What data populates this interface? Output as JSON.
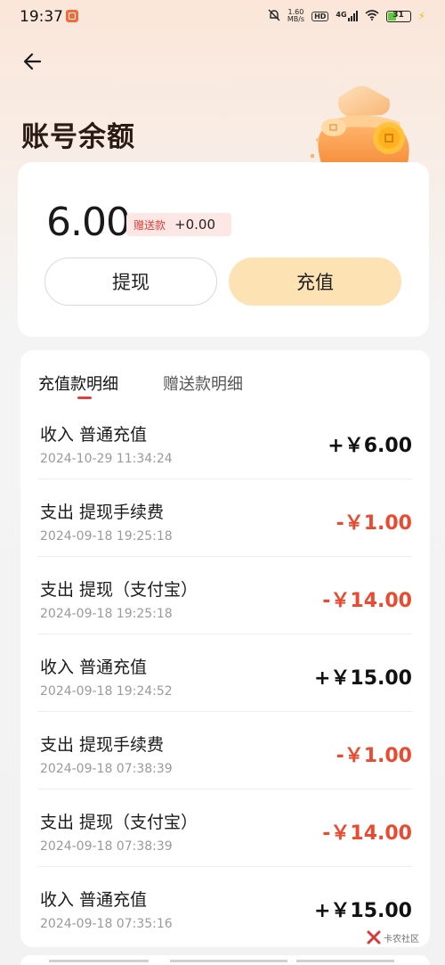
{
  "status_bar": {
    "time": "19:37",
    "net_speed_value": "1.60",
    "net_speed_unit": "MB/s",
    "hd_label": "HD",
    "network_type": "4G",
    "battery": "31"
  },
  "header": {
    "title": "账号余额"
  },
  "balance": {
    "amount": "6.00",
    "bonus_label": "赠送款",
    "bonus_value": "+0.00",
    "withdraw_label": "提现",
    "recharge_label": "充值"
  },
  "tabs": [
    {
      "label": "充值款明细",
      "active": true
    },
    {
      "label": "赠送款明细",
      "active": false
    }
  ],
  "transactions": [
    {
      "title": "收入 普通充值",
      "time": "2024-10-29 11:34:24",
      "amount": "+￥6.00",
      "type": "income"
    },
    {
      "title": "支出 提现手续费",
      "time": "2024-09-18 19:25:18",
      "amount": "-￥1.00",
      "type": "expense"
    },
    {
      "title": "支出 提现（支付宝）",
      "time": "2024-09-18 19:25:18",
      "amount": "-￥14.00",
      "type": "expense"
    },
    {
      "title": "收入 普通充值",
      "time": "2024-09-18 19:24:52",
      "amount": "+￥15.00",
      "type": "income"
    },
    {
      "title": "支出 提现手续费",
      "time": "2024-09-18 07:38:39",
      "amount": "-￥1.00",
      "type": "expense"
    },
    {
      "title": "支出 提现（支付宝）",
      "time": "2024-09-18 07:38:39",
      "amount": "-￥14.00",
      "type": "expense"
    },
    {
      "title": "收入 普通充值",
      "time": "2024-09-18 07:35:16",
      "amount": "+￥15.00",
      "type": "income"
    }
  ],
  "watermark": {
    "text": "卡农社区"
  },
  "colors": {
    "accent_red": "#ea4a2f",
    "recharge_button": "#fde2b4",
    "bonus_tag_bg": "#fde7e4"
  }
}
